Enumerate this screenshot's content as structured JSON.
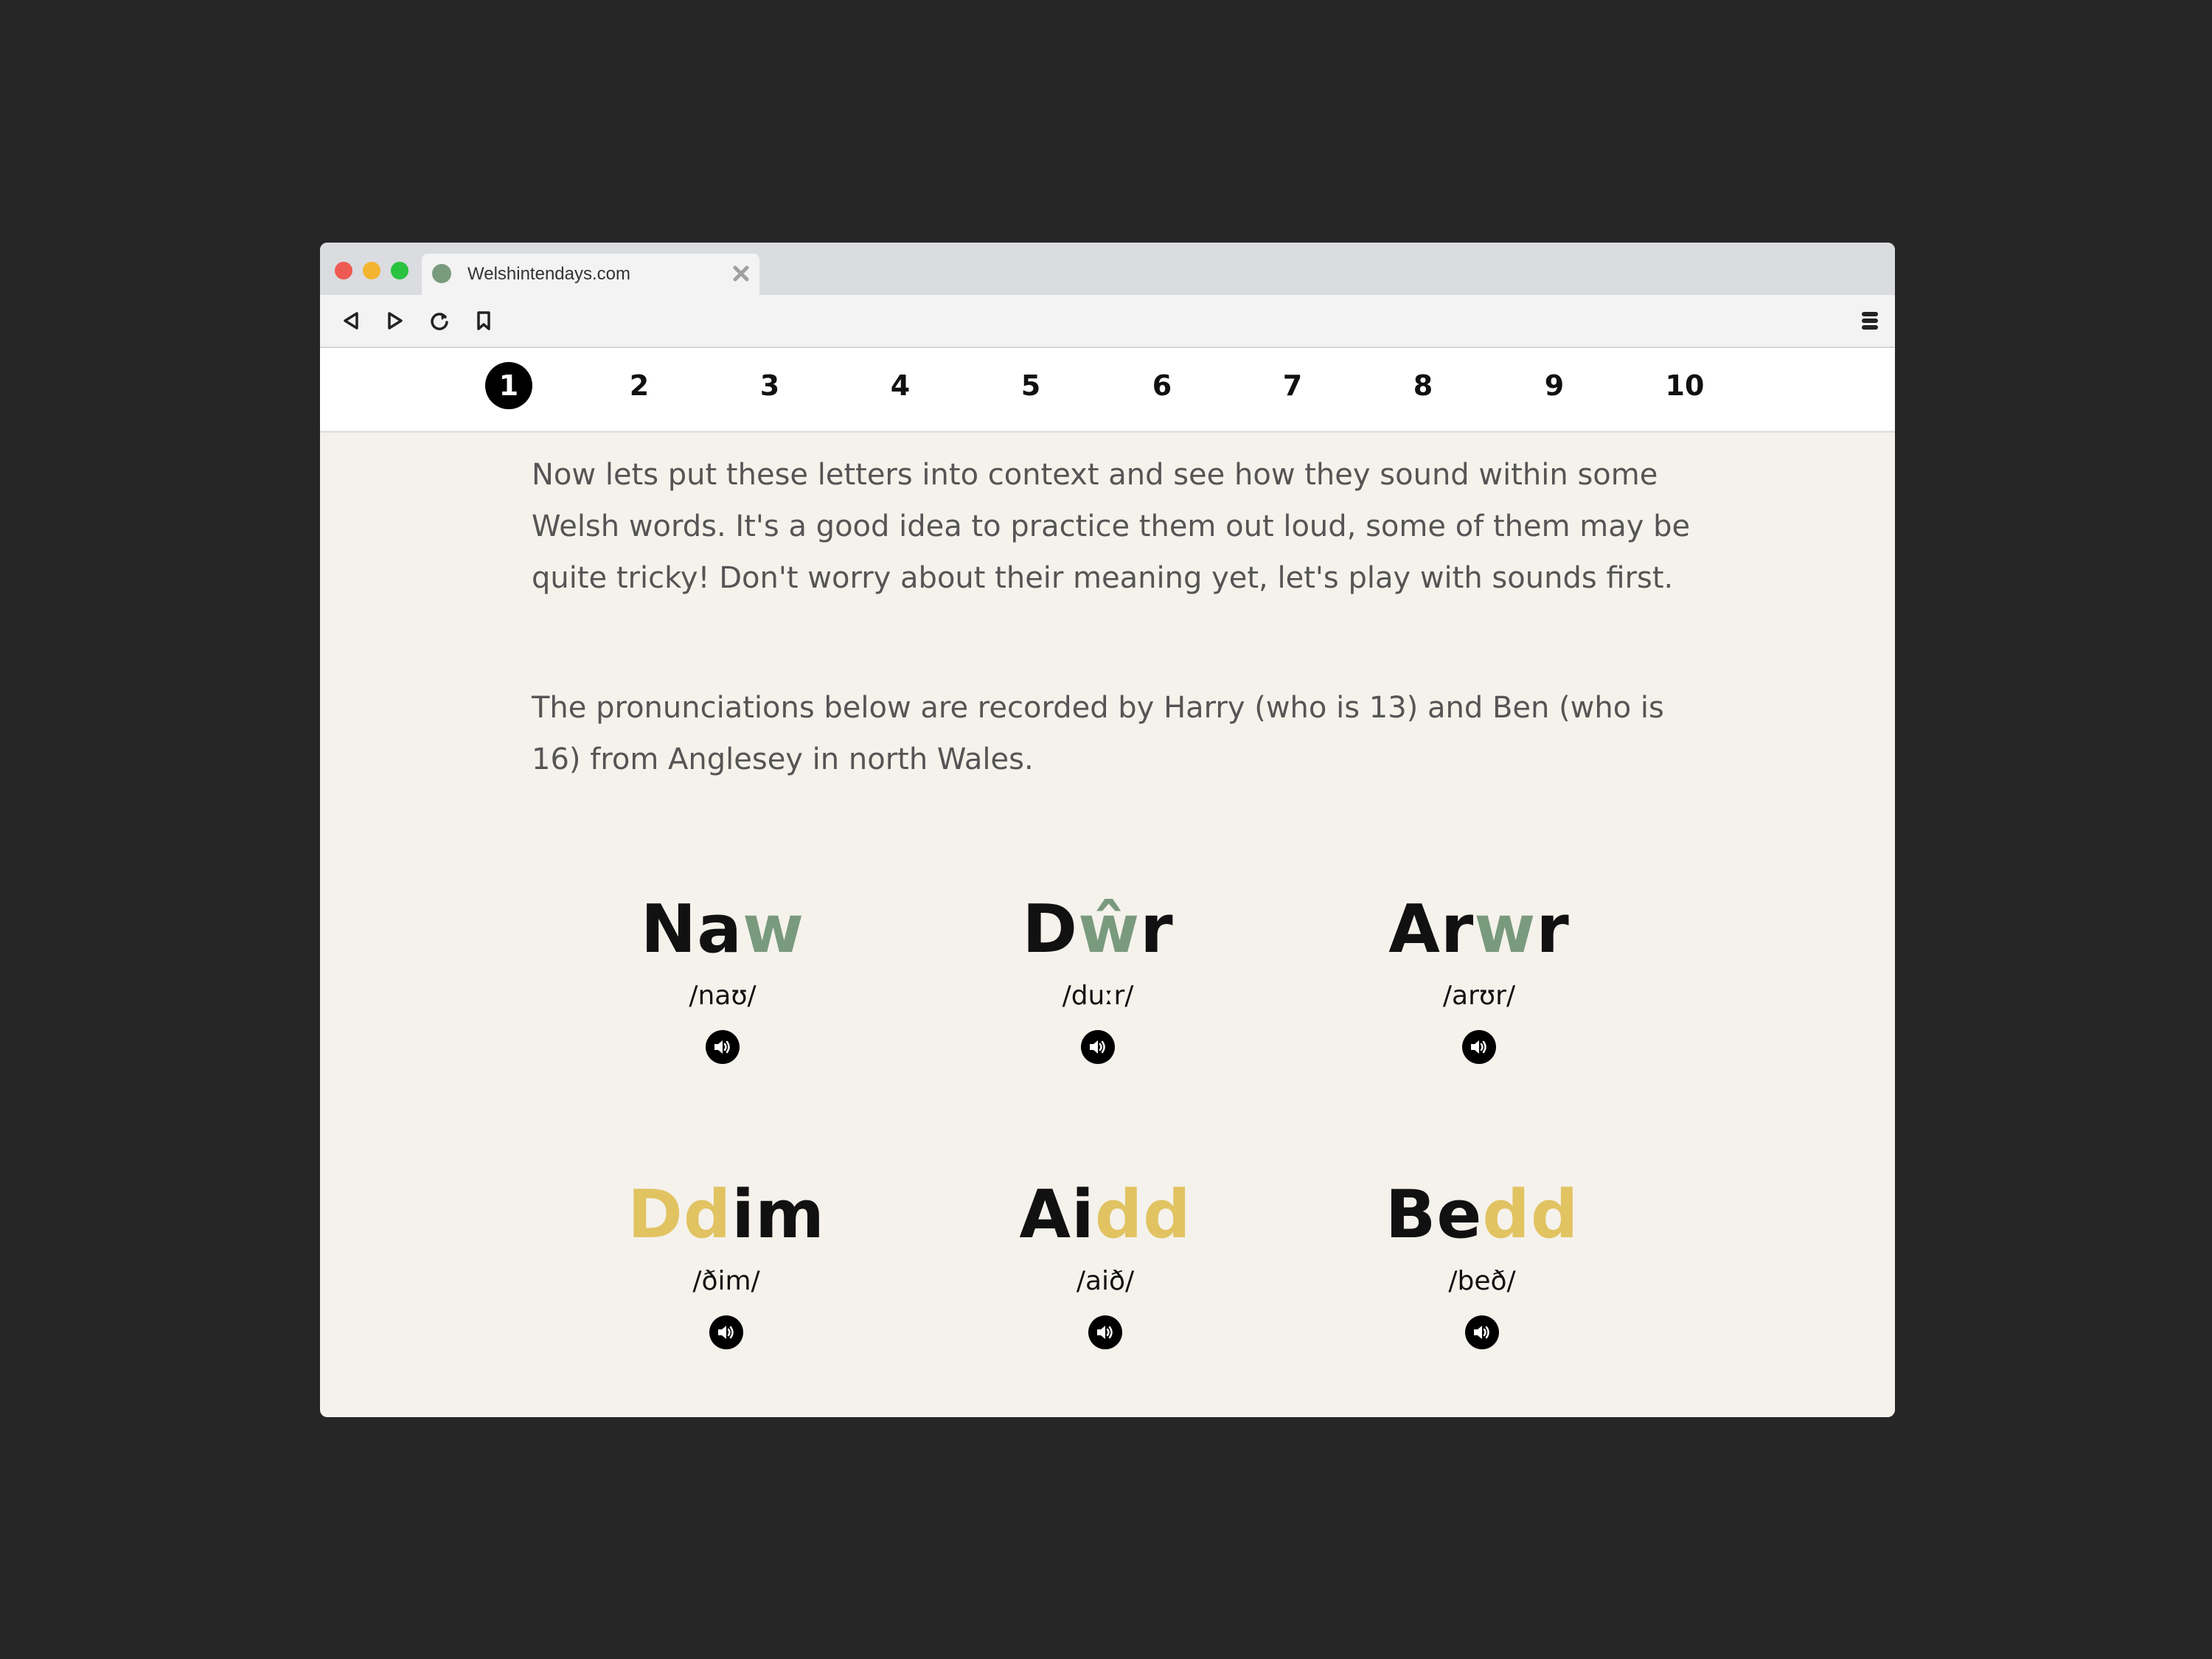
{
  "browser": {
    "tab_title": "Welshintendays.com",
    "icons": {
      "back": "back-icon",
      "forward": "forward-icon",
      "reload": "reload-icon",
      "bookmark": "bookmark-icon",
      "menu": "menu-icon",
      "close": "close-tab-icon"
    }
  },
  "pagination": {
    "active": "1",
    "pages": [
      "1",
      "2",
      "3",
      "4",
      "5",
      "6",
      "7",
      "8",
      "9",
      "10"
    ]
  },
  "intro": {
    "paragraph1": "Now lets put these letters into context and see how they sound within some Welsh words. It's a good idea to practice them out loud, some of them may be quite tricky! Don't worry about their meaning yet, let's play with sounds first.",
    "paragraph2": "The pronunciations below are recorded by Harry (who is 13) and Ben (who is 16) from Anglesey in north Wales."
  },
  "words": [
    {
      "word": "Naw",
      "pre": "Na",
      "highlight": "w",
      "post": "",
      "color": "#7a9a7e",
      "ipa": "/naʊ/"
    },
    {
      "word": "Dŵr",
      "pre": "D",
      "highlight": "ŵ",
      "post": "r",
      "color": "#7a9a7e",
      "ipa": "/duːr/"
    },
    {
      "word": "Arwr",
      "pre": "Ar",
      "highlight": "w",
      "post": "r",
      "color": "#7a9a7e",
      "ipa": "/arʊr/"
    },
    {
      "word": "Ddim",
      "pre": "",
      "highlight": "Dd",
      "post": "im",
      "color": "#e1c362",
      "ipa": "/ðim/"
    },
    {
      "word": "Aidd",
      "pre": "Ai",
      "highlight": "dd",
      "post": "",
      "color": "#e1c362",
      "ipa": "/aið/"
    },
    {
      "word": "Bedd",
      "pre": "Be",
      "highlight": "dd",
      "post": "",
      "color": "#e1c362",
      "ipa": "/beð/"
    }
  ],
  "colors": {
    "green_highlight": "#7a9a7e",
    "gold_highlight": "#e1c362",
    "content_background": "#f5f2ec"
  }
}
